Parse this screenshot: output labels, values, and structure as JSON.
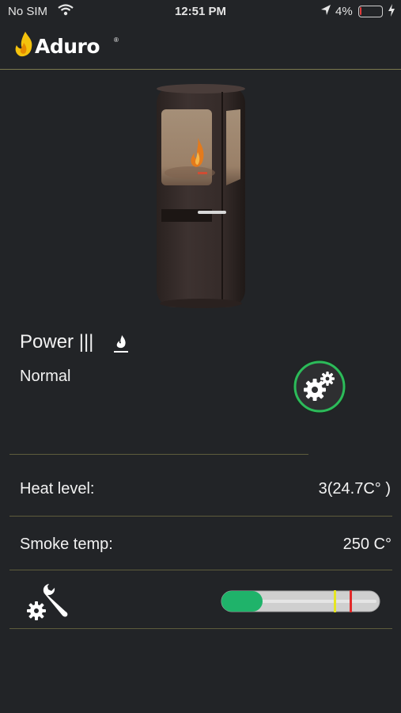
{
  "status_bar": {
    "carrier": "No SIM",
    "time": "12:51 PM",
    "battery": "4%",
    "battery_level_percent": 4
  },
  "header": {
    "brand": "Aduro",
    "brand_mark": "®"
  },
  "stove": {
    "power_label": "Power",
    "power_bars": "|||",
    "mode": "Normal"
  },
  "readings": {
    "heat_level_label": "Heat level:",
    "heat_level_value": "3(24.7C° )",
    "smoke_temp_label": "Smoke temp:",
    "smoke_temp_value": "250 C°"
  },
  "smoke_gauge": {
    "level_fraction": 0.26,
    "warn_fraction": 0.71,
    "limit_fraction": 0.81
  },
  "colors": {
    "background": "#222427",
    "separator": "#5e5c3c",
    "gauge_green": "#1fb36a",
    "gauge_yellow": "#e5e522",
    "gauge_red": "#e22a2a"
  }
}
